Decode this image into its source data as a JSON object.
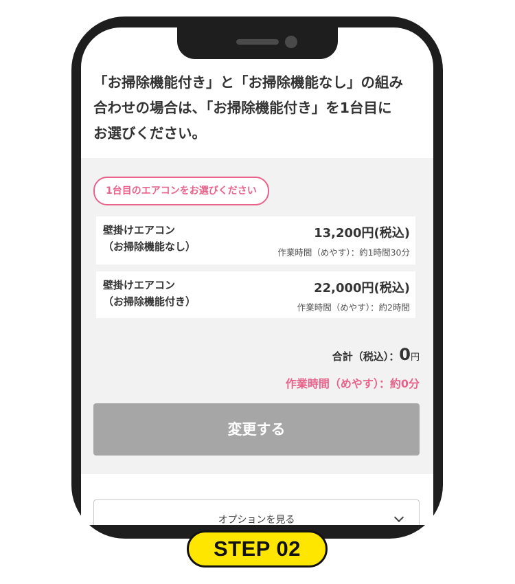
{
  "intro": {
    "line1": "「お掃除機能付き」と「お掃除機能なし」の組み",
    "line2": "合わせの場合は、「お掃除機能付き」を1台目に",
    "line3": "お選びください。"
  },
  "selector": {
    "pill_label": "1台目のエアコンをお選びください",
    "options": [
      {
        "name_line1": "壁掛けエアコン",
        "name_line2": "（お掃除機能なし）",
        "price": "13,200円(税込)",
        "time": "作業時間（めやす）：約1時間30分"
      },
      {
        "name_line1": "壁掛けエアコン",
        "name_line2": "（お掃除機能付き）",
        "price": "22,000円(税込)",
        "time": "作業時間（めやす）：約2時間"
      }
    ]
  },
  "summary": {
    "total_label": "合計（税込）：",
    "total_value": "0",
    "total_unit": "円",
    "work_time": "作業時間（めやす）：約0分"
  },
  "actions": {
    "change_label": "変更する",
    "options_label": "オプションを見る"
  },
  "badge": {
    "step_label": "STEP 02"
  },
  "colors": {
    "accent_pink": "#e8638c",
    "badge_yellow": "#ffe600",
    "disabled_button": "#a6a6a6",
    "panel_bg": "#f2f2f2"
  }
}
